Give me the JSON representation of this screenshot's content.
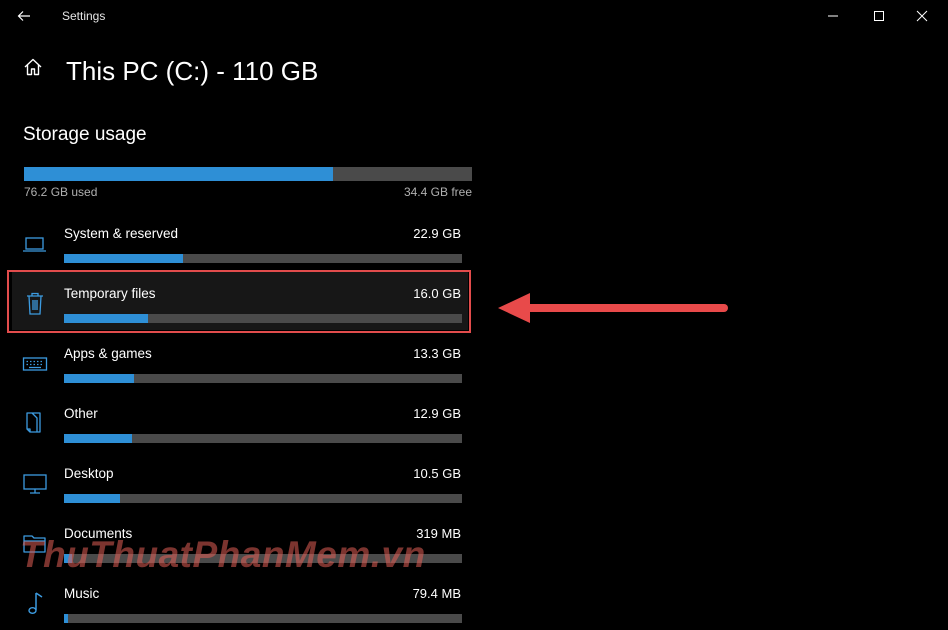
{
  "app": {
    "title": "Settings"
  },
  "page": {
    "title": "This PC (C:) - 110 GB"
  },
  "storage": {
    "section_title": "Storage usage",
    "used_label": "76.2 GB used",
    "free_label": "34.4 GB free",
    "used_fraction": 0.69
  },
  "categories": [
    {
      "name": "System & reserved",
      "size": "22.9 GB",
      "fraction": 0.3,
      "icon": "laptop-icon"
    },
    {
      "name": "Temporary files",
      "size": "16.0 GB",
      "fraction": 0.21,
      "icon": "trash-icon",
      "highlighted": true
    },
    {
      "name": "Apps & games",
      "size": "13.3 GB",
      "fraction": 0.175,
      "icon": "keyboard-icon"
    },
    {
      "name": "Other",
      "size": "12.9 GB",
      "fraction": 0.17,
      "icon": "other-files-icon"
    },
    {
      "name": "Desktop",
      "size": "10.5 GB",
      "fraction": 0.14,
      "icon": "monitor-icon"
    },
    {
      "name": "Documents",
      "size": "319 MB",
      "fraction": 0.02,
      "icon": "folder-icon"
    },
    {
      "name": "Music",
      "size": "79.4 MB",
      "fraction": 0.01,
      "icon": "music-icon"
    }
  ],
  "watermark": {
    "text": "ThuThuatPhanMem.vn"
  },
  "colors": {
    "accent": "#2e8fd6",
    "track": "#4a4a4a",
    "highlight_border": "#e24c4c",
    "arrow": "#e84a4a",
    "background": "#000000"
  }
}
